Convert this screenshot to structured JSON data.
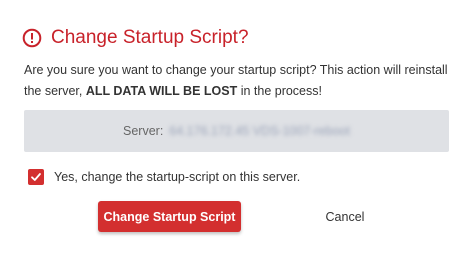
{
  "dialog": {
    "title": "Change Startup Script?",
    "icon": "warning-circle-icon",
    "message_part1": "Are you sure you want to change your startup script? This action will reinstall the server, ",
    "message_strong": "ALL DATA WILL BE LOST",
    "message_part2": " in the process!",
    "server_label": "Server:",
    "server_value": "64.176.172.45 VDS-1007-reboot",
    "confirm_checkbox": {
      "checked": true,
      "label": "Yes, change the startup-script on this server."
    },
    "primary_button": "Change Startup Script",
    "cancel_button": "Cancel"
  },
  "colors": {
    "accent": "#d32f2f",
    "title": "#c8222a",
    "server_box_bg": "#dfe1e5"
  }
}
